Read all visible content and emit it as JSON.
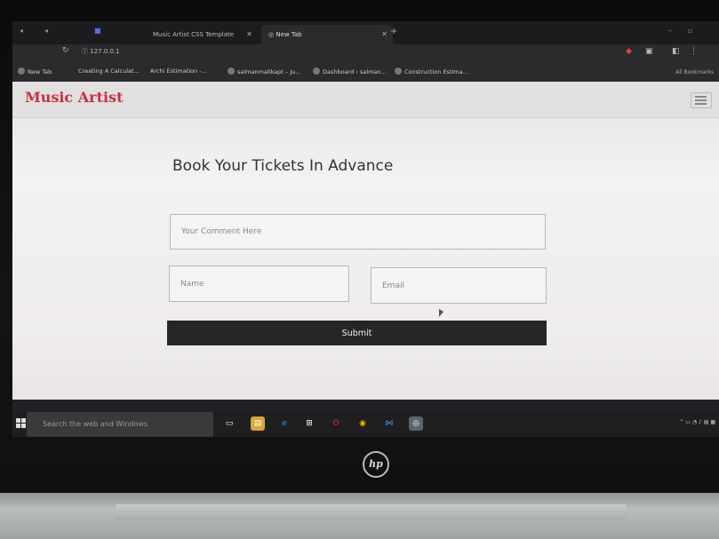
{
  "browser": {
    "tabs": [
      {
        "label": "Music Artist CSS Template",
        "active": false
      },
      {
        "label": "New Tab",
        "active": true
      }
    ],
    "address": "127.0.0.1",
    "bookmarks": [
      "New Tab",
      "Creating A Calculat...",
      "Archi Estimation -...",
      "salmanmalikapt – Ju...",
      "Dashboard ‹ salman...",
      "Construction Estima..."
    ],
    "all_bookmarks": "All Bookmarks"
  },
  "site": {
    "brand": "Music Artist",
    "heading": "Book Your Tickets In Advance",
    "form": {
      "comment_placeholder": "Your Comment Here",
      "name_placeholder": "Name",
      "email_placeholder": "Email",
      "submit_label": "Submit"
    }
  },
  "taskbar": {
    "search_placeholder": "Search the web and Windows"
  },
  "colors": {
    "brand": "#c6313f",
    "submit_bg": "#262626",
    "page_bg": "#efeced"
  }
}
